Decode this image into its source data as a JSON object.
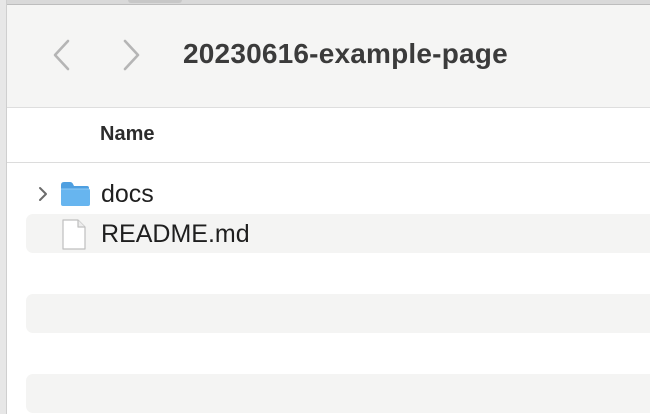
{
  "window": {
    "title": "20230616-example-page"
  },
  "toolbar": {
    "back_icon": "chevron-left-icon",
    "forward_icon": "chevron-right-icon"
  },
  "list": {
    "column_header": "Name",
    "items": [
      {
        "label": "docs",
        "kind": "folder",
        "icon": "folder-icon",
        "expandable": true
      },
      {
        "label": "README.md",
        "kind": "file",
        "icon": "document-icon",
        "expandable": false
      }
    ]
  },
  "colors": {
    "toolbar_bg": "#f5f5f4",
    "stripe_bg": "#f4f4f3",
    "folder_blue": "#5aaee8",
    "title_text": "#3b3b3b"
  }
}
